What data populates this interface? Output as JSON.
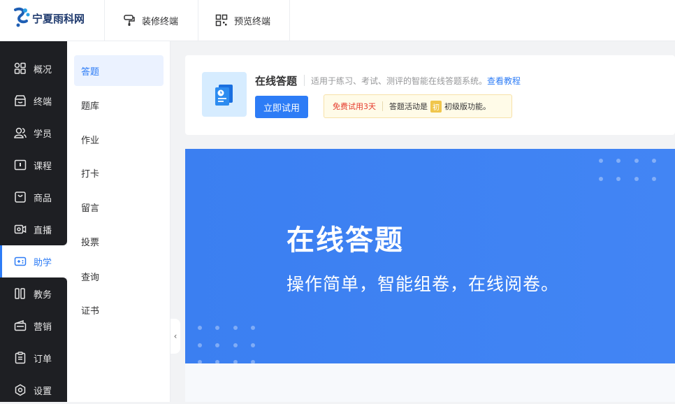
{
  "brand": {
    "name": "宁夏雨科网"
  },
  "top_tabs": [
    {
      "label": "装修终端",
      "icon": "paint-roller-icon"
    },
    {
      "label": "预览终端",
      "icon": "qr-code-icon"
    }
  ],
  "nav": {
    "items": [
      {
        "label": "概况",
        "icon": "grid-icon"
      },
      {
        "label": "终端",
        "icon": "shop-icon"
      },
      {
        "label": "学员",
        "icon": "users-icon"
      },
      {
        "label": "课程",
        "icon": "course-icon"
      },
      {
        "label": "商品",
        "icon": "bag-icon"
      },
      {
        "label": "直播",
        "icon": "video-icon"
      },
      {
        "label": "助学",
        "icon": "gamepad-icon",
        "active": true
      },
      {
        "label": "教务",
        "icon": "books-icon"
      },
      {
        "label": "营销",
        "icon": "wallet-icon"
      },
      {
        "label": "订单",
        "icon": "clipboard-icon"
      },
      {
        "label": "设置",
        "icon": "settings-icon"
      }
    ]
  },
  "subnav": {
    "items": [
      {
        "label": "答题",
        "active": true
      },
      {
        "label": "题库"
      },
      {
        "label": "作业"
      },
      {
        "label": "打卡"
      },
      {
        "label": "留言"
      },
      {
        "label": "投票"
      },
      {
        "label": "查询"
      },
      {
        "label": "证书"
      }
    ]
  },
  "app": {
    "title": "在线答题",
    "desc": "适用于练习、考试、测评的智能在线答题系统。",
    "link": "查看教程",
    "try_label": "立即试用",
    "notice": {
      "trial": "免费试用3天",
      "text_before": "答题活动是",
      "badge": "初",
      "text_after": "初级版功能。"
    }
  },
  "banner": {
    "title": "在线答题",
    "subtitle": "操作简单，智能组卷，在线阅卷。"
  },
  "colors": {
    "accent": "#2d7cf6",
    "nav_bg": "#1e1f23",
    "banner": "#3b7ff1"
  }
}
